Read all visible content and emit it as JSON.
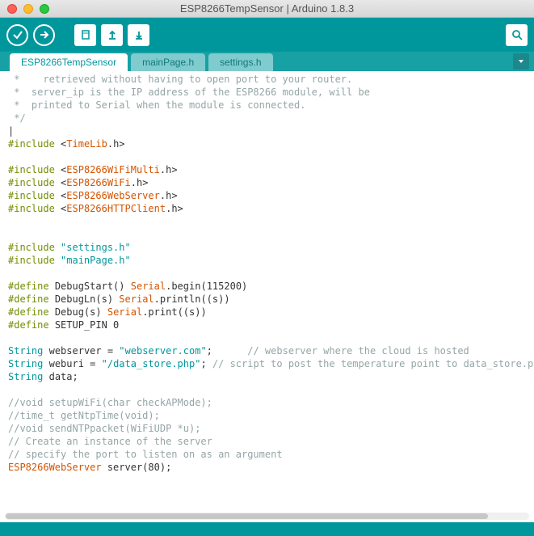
{
  "window": {
    "title": "ESP8266TempSensor | Arduino 1.8.3"
  },
  "tabs": [
    {
      "label": "ESP8266TempSensor",
      "active": true
    },
    {
      "label": "mainPage.h",
      "active": false
    },
    {
      "label": "settings.h",
      "active": false
    }
  ],
  "code": {
    "c1": " *    retrieved without having to open port to your router.",
    "c2": " *  server_ip is the IP address of the ESP8266 module, will be",
    "c3": " *  printed to Serial when the module is connected.",
    "c4": " */",
    "cursor": "|",
    "inc_kw": "#include",
    "inc1": "TimeLib",
    "inc2": "ESP8266WiFiMulti",
    "inc3": "ESP8266WiFi",
    "inc4": "ESP8266WebServer",
    "inc5": "ESP8266HTTPClient",
    "hsuffix": ".h",
    "lt": "<",
    "gt": ">",
    "incq1": "\"settings.h\"",
    "incq2": "\"mainPage.h\"",
    "def_kw": "#define",
    "def1_name": "DebugStart()",
    "def1_fn": "Serial",
    "def1_call": ".begin",
    "def1_args": "(115200)",
    "def2_name": "DebugLn(s)",
    "def2_fn": "Serial",
    "def2_call": ".println",
    "def2_args": "((s))",
    "def3_name": "Debug(s)",
    "def3_fn": "Serial",
    "def3_call": ".print",
    "def3_args": "((s))",
    "def4": "SETUP_PIN 0",
    "type_str": "String",
    "v1_name": "webserver = ",
    "v1_val": "\"webserver.com\"",
    "v1_end": ";      ",
    "v1_cm": "// webserver where the cloud is hosted",
    "v2_name": "weburi = ",
    "v2_val": "\"/data_store.php\"",
    "v2_end": "; ",
    "v2_cm": "// script to post the temperature point to data_store.ph",
    "v3": "data;",
    "cm5": "//void setupWiFi(char checkAPMode);",
    "cm6": "//time_t getNtpTime(void);",
    "cm7": "//void sendNTPpacket(WiFiUDP *u);",
    "cm8": "// Create an instance of the server",
    "cm9": "// specify the port to listen on as an argument",
    "srv_type": "ESP8266WebServer",
    "srv_decl": " server(80);"
  }
}
